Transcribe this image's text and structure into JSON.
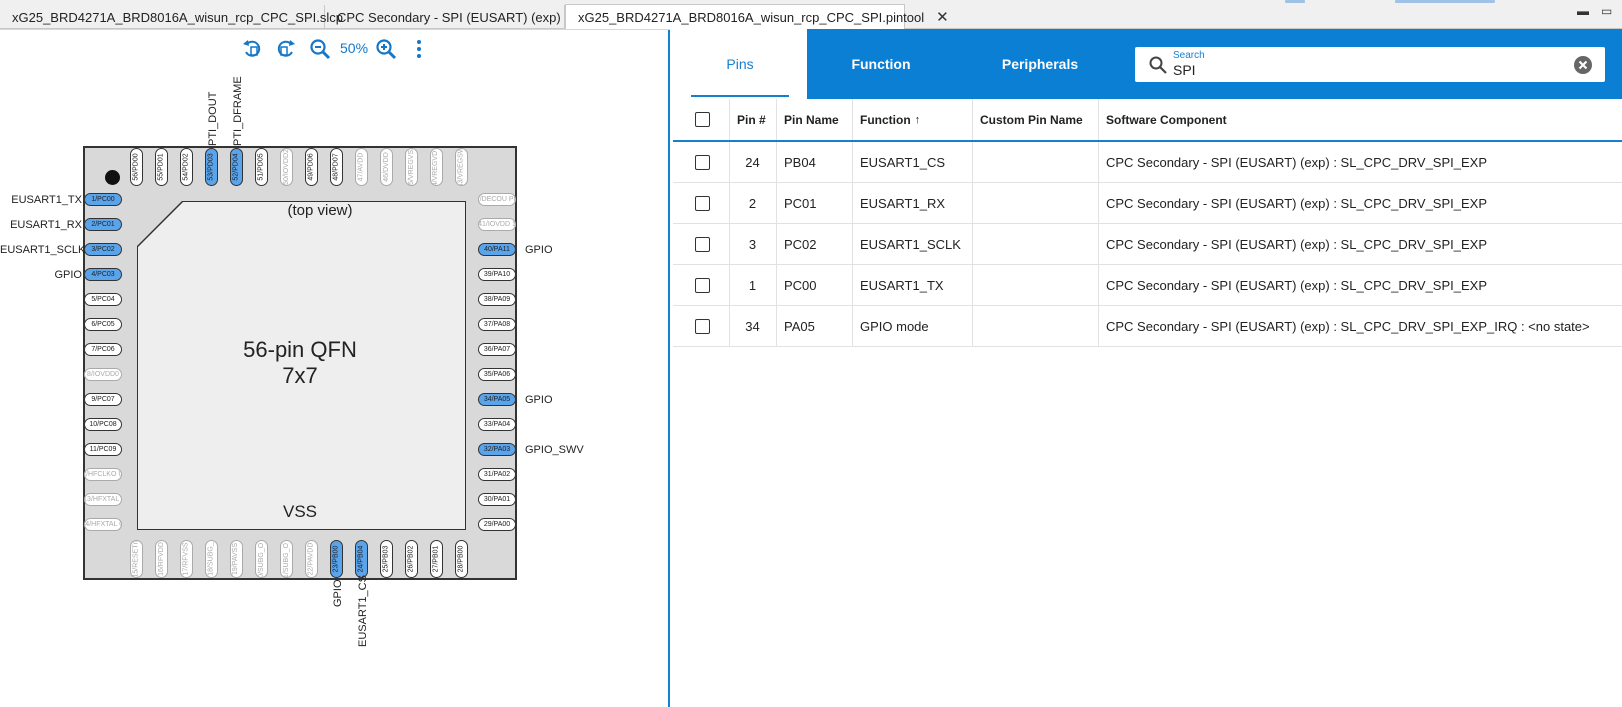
{
  "tabs": [
    {
      "label": "xG25_BRD4271A_BRD8016A_wisun_rcp_CPC_SPI.slcp",
      "icon": "slcp-project-icon"
    },
    {
      "label": "CPC Secondary - SPI (EUSART) (exp)",
      "icon": "component-icon"
    },
    {
      "label": "xG25_BRD4271A_BRD8016A_wisun_rcp_CPC_SPI.pintool",
      "icon": "pintool-chip-icon",
      "active": true
    }
  ],
  "toolbar": {
    "zoom": "50%"
  },
  "chip": {
    "top_view": "(top view)",
    "package_line1": "56-pin QFN",
    "package_line2": "7x7",
    "bottom_label": "VSS",
    "left_pins": [
      {
        "label": "1/PC00",
        "on": true
      },
      {
        "label": "2/PC01",
        "on": true
      },
      {
        "label": "3/PC02",
        "on": true
      },
      {
        "label": "4/PC03",
        "on": true
      },
      {
        "label": "5/PC04"
      },
      {
        "label": "6/PC05"
      },
      {
        "label": "7/PC06"
      },
      {
        "label": "8/IOVDD0",
        "dim": true
      },
      {
        "label": "9/PC07"
      },
      {
        "label": "10/PC08"
      },
      {
        "label": "11/PC09"
      },
      {
        "label": "12/HFCLKO UT",
        "dim": true
      },
      {
        "label": "13/HFXTAL I",
        "dim": true
      },
      {
        "label": "14/HFXTAL O",
        "dim": true
      }
    ],
    "right_pins": [
      {
        "label": "42/DECOU PLE",
        "dim": true
      },
      {
        "label": "41/IOVDD 1",
        "dim": true
      },
      {
        "label": "40/PA11",
        "on": true
      },
      {
        "label": "39/PA10"
      },
      {
        "label": "38/PA09"
      },
      {
        "label": "37/PA08"
      },
      {
        "label": "36/PA07"
      },
      {
        "label": "35/PA06"
      },
      {
        "label": "34/PA05",
        "on": true
      },
      {
        "label": "33/PA04"
      },
      {
        "label": "32/PA03",
        "on": true
      },
      {
        "label": "31/PA02"
      },
      {
        "label": "30/PA01"
      },
      {
        "label": "29/PA00"
      }
    ],
    "top_pins": [
      {
        "label": "56/PD00"
      },
      {
        "label": "55/PD01"
      },
      {
        "label": "54/PD02"
      },
      {
        "label": "53/PD03",
        "on": true
      },
      {
        "label": "52/PD04",
        "on": true
      },
      {
        "label": "51/PD05"
      },
      {
        "label": "50/IOVDD2",
        "dim": true
      },
      {
        "label": "49/PD06"
      },
      {
        "label": "48/PD07"
      },
      {
        "label": "47/AVDD",
        "dim": true
      },
      {
        "label": "46/DVDD",
        "dim": true
      },
      {
        "label": "45/VREGVSS",
        "dim": true
      },
      {
        "label": "44/VREGVD D",
        "dim": true
      },
      {
        "label": "43/VREGSW",
        "dim": true
      }
    ],
    "bottom_pins": [
      {
        "label": "15/RESETn",
        "dim": true
      },
      {
        "label": "16/RFVDD",
        "dim": true
      },
      {
        "label": "17/RFVSS",
        "dim": true
      },
      {
        "label": "18/SUBG_",
        "dim": true
      },
      {
        "label": "19/PAVSS",
        "dim": true
      },
      {
        "label": "20/SUBG_O P",
        "dim": true
      },
      {
        "label": "21/SUBG_O N",
        "dim": true
      },
      {
        "label": "22/PAVDD",
        "dim": true
      },
      {
        "label": "23/PB00",
        "on": true
      },
      {
        "label": "24/PB04",
        "on": true
      },
      {
        "label": "25/PB03"
      },
      {
        "label": "26/PB02"
      },
      {
        "label": "27/PB01"
      },
      {
        "label": "28/PB00"
      }
    ],
    "signals": {
      "left": [
        "EUSART1_TX",
        "EUSART1_RX",
        "EUSART1_SCLK",
        "GPIO"
      ],
      "right_pa11": "GPIO",
      "right_pa05": "GPIO",
      "right_pa03": "GPIO_SWV",
      "top_pd03": "PTI_DOUT",
      "top_pd04": "PTI_DFRAME",
      "bottom_pb00": "GPIO",
      "bottom_pb04": "EUSART1_CS"
    }
  },
  "panel_tabs": {
    "pins": "Pins",
    "function": "Function",
    "peripherals": "Peripherals"
  },
  "search": {
    "label": "Search",
    "value": "SPI"
  },
  "table": {
    "headers": {
      "pin": "Pin #",
      "name": "Pin Name",
      "function": "Function",
      "custom": "Custom Pin Name",
      "software": "Software Component"
    },
    "rows": [
      {
        "pin": "24",
        "name": "PB04",
        "function": "EUSART1_CS",
        "custom": "",
        "software": "CPC Secondary - SPI (EUSART) (exp) : SL_CPC_DRV_SPI_EXP"
      },
      {
        "pin": "2",
        "name": "PC01",
        "function": "EUSART1_RX",
        "custom": "",
        "software": "CPC Secondary - SPI (EUSART) (exp) : SL_CPC_DRV_SPI_EXP"
      },
      {
        "pin": "3",
        "name": "PC02",
        "function": "EUSART1_SCLK",
        "custom": "",
        "software": "CPC Secondary - SPI (EUSART) (exp) : SL_CPC_DRV_SPI_EXP"
      },
      {
        "pin": "1",
        "name": "PC00",
        "function": "EUSART1_TX",
        "custom": "",
        "software": "CPC Secondary - SPI (EUSART) (exp) : SL_CPC_DRV_SPI_EXP"
      },
      {
        "pin": "34",
        "name": "PA05",
        "function": "GPIO mode",
        "custom": "",
        "software": "CPC Secondary - SPI (EUSART) (exp) : SL_CPC_DRV_SPI_EXP_IRQ : <no state>"
      }
    ]
  }
}
